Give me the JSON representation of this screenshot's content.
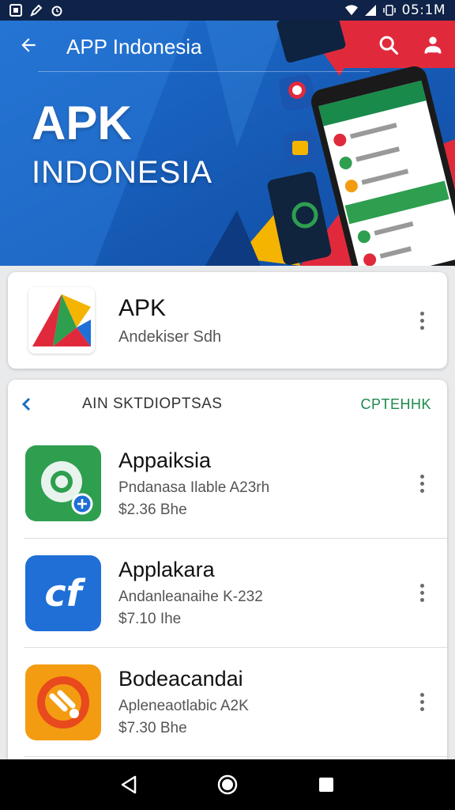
{
  "status_bar": {
    "time": "05:1M",
    "left_icons": [
      "gallery-icon",
      "edit-icon",
      "alarm-icon"
    ],
    "right_icons": [
      "wifi-icon",
      "signal-icon",
      "vibrate-icon"
    ]
  },
  "app_bar": {
    "title": "APP Indonesia",
    "icons": [
      "back-arrow-icon",
      "search-icon",
      "account-icon"
    ]
  },
  "banner": {
    "headline": "APK",
    "subheadline": "INDONESIA",
    "colors": {
      "blue": "#1b5fb8",
      "red": "#e02a3c",
      "yellow": "#f4b400",
      "green": "#1a8a4a"
    }
  },
  "featured": {
    "name": "APK",
    "developer": "Andekiser Sdh",
    "icon": "apk-triangle-logo-icon"
  },
  "list": {
    "section_title": "AIN SKTDIOPTSAS",
    "see_more": "CPTEHHK",
    "items": [
      {
        "name": "Appaiksia",
        "desc": "Pndanasa Ilable A23rh",
        "price": "$2.36 Bhe",
        "icon": "green-ring-app-icon",
        "color": "#2e9e4f"
      },
      {
        "name": "Applakara",
        "desc": "Andanleanaihe K-232",
        "price": "$7.10 Ihe",
        "icon": "cf-app-icon",
        "color": "#1f6fd6"
      },
      {
        "name": "Bodeacandai",
        "desc": "Apleneaotlabic A2K",
        "price": "$7.30 Bhe",
        "icon": "orange-tools-app-icon",
        "color": "#f39c12"
      }
    ]
  },
  "nav_bar": {
    "icons": [
      "back-nav-icon",
      "home-nav-icon",
      "recents-nav-icon"
    ]
  }
}
